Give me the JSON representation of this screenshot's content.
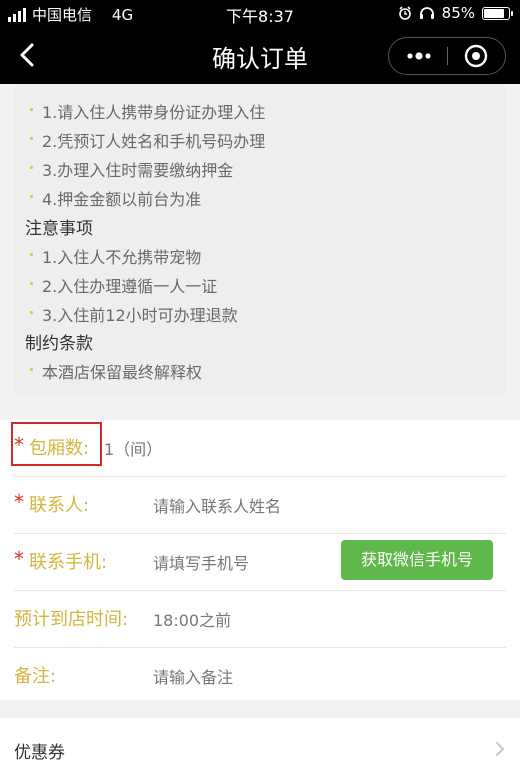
{
  "status_bar": {
    "carrier": "中国电信",
    "network": "4G",
    "time": "下午8:37",
    "battery": "85%",
    "battery_level": 0.85
  },
  "nav": {
    "title": "确认订单",
    "back_icon": "back-arrow-icon",
    "menu_icon": "more-dots-icon",
    "close_icon": "target-circle-icon"
  },
  "rules": {
    "check_in_items": [
      "1.请入住人携带身份证办理入住",
      "2.凭预订人姓名和手机号码办理",
      "3.办理入住时需要缴纳押金",
      "4.押金金额以前台为准"
    ],
    "notice_title": "注意事项",
    "notice_items": [
      "1.入住人不允携带宠物",
      "2.入住办理遵循一人一证",
      "3.入住前12小时可办理退款"
    ],
    "terms_title": "制约条款",
    "terms_items": [
      "本酒店保留最终解释权"
    ]
  },
  "form": {
    "rooms": {
      "label": "包厢数:",
      "value": "1（间）"
    },
    "contact": {
      "label": "联系人:",
      "placeholder": "请输入联系人姓名"
    },
    "phone": {
      "label": "联系手机:",
      "placeholder": "请填写手机号",
      "button": "获取微信手机号"
    },
    "arrival": {
      "label": "预计到店时间:",
      "value": "18:00之前"
    },
    "remark": {
      "label": "备注:",
      "placeholder": "请输入备注"
    },
    "required_mark": "*"
  },
  "coupon": {
    "label": "优惠券",
    "chevron_icon": "chevron-right-icon"
  },
  "colors": {
    "accent_green": "#61b84a",
    "label_gold": "#d3b640",
    "required_red": "#d9352b",
    "highlight_red": "#cf2b2b"
  }
}
